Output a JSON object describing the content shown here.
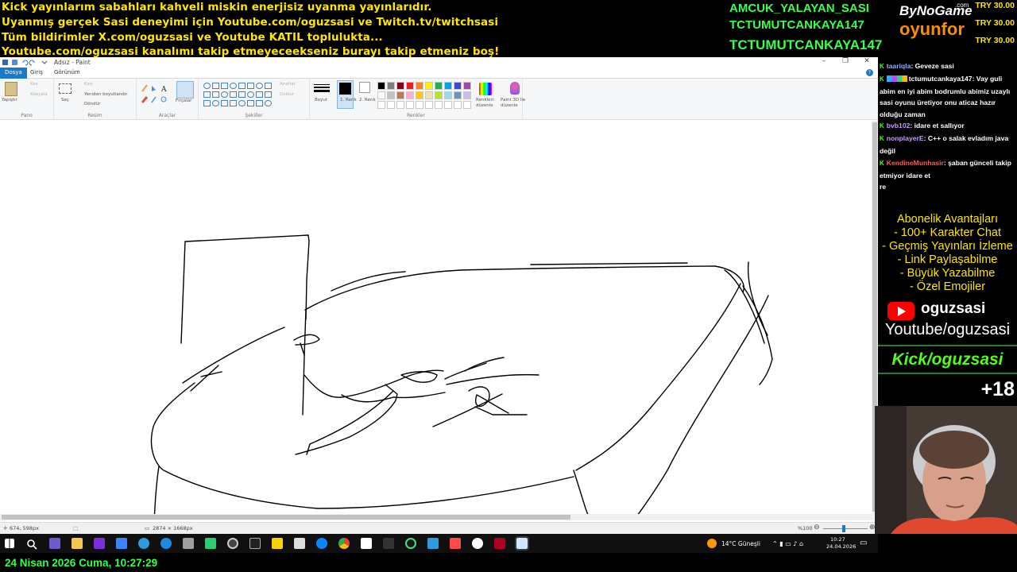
{
  "banner": {
    "lines": [
      "Kick yayınlarım sabahları kahveli miskin enerjisiz uyanma yayınlarıdır.",
      "Uyanmış gerçek Sasi deneyimi için Youtube.com/oguzsasi ve Twitch.tv/twitchsasi",
      "Tüm bildirimler X.com/oguzsasi ve Youtube KATIL topluluktа...",
      "Youtube.com/oguzsasi kanalımı takip etmeyeceekseniz burayı takip etmeniz boş!"
    ],
    "top_names": [
      "AMCUK_YALAYAN_SASI",
      "TCTUMUTCANKAYA147",
      "TCTUMUTCANKAYA147"
    ],
    "brand_line1": "ByNoGame",
    "brand_suffix": ".com",
    "brand_line2": "oyunfor",
    "donations": [
      "TRY 30.00",
      "TRY 30.00",
      "TRY 30.00"
    ]
  },
  "paint": {
    "window_title": "Adsız - Paint",
    "menu_tabs": [
      "Dosya",
      "Giriş",
      "Görünüm"
    ],
    "ribbon": {
      "paste_label": "Yapıştır",
      "cut_label": "Kes",
      "copy_label": "Kopyala",
      "select_label": "Seç",
      "crop_label": "Kırp",
      "resize_label": "Yeniden boyutlandır",
      "rotate_label": "Döndür",
      "brushes_label": "Fırçalar",
      "outline_label": "Anahat",
      "fill_label": "Doldur",
      "size_label": "Boyut",
      "color1_label": "1. Renk",
      "color2_label": "2. Renk",
      "edit_colors_label": "Renkleri düzenle",
      "paint3d_label": "Paint 3D ile düzenle",
      "groups": [
        "Pano",
        "Resim",
        "Araçlar",
        "Şekiller",
        "Renkler"
      ]
    },
    "palette": [
      "#000000",
      "#7f7f7f",
      "#880015",
      "#ed1c24",
      "#ff7f27",
      "#fff200",
      "#22b14c",
      "#00a2e8",
      "#3f48cc",
      "#a349a4",
      "#ffffff",
      "#c3c3c3",
      "#b97a57",
      "#ffaec9",
      "#ffc90e",
      "#efe4b0",
      "#b5e61d",
      "#99d9ea",
      "#7092be",
      "#c8bfe7"
    ],
    "status": {
      "cursor_pos": "674, 598px",
      "canvas_size": "2874 × 1668px",
      "zoom": "%100"
    }
  },
  "chat": {
    "messages": [
      {
        "user": "taariqla",
        "user_color": "#8ab4ff",
        "text": ": Geveze sasi",
        "badges": false
      },
      {
        "user": "tctumutcankaya147",
        "user_color": "#ffffff",
        "text": ": Vay guli abim en iyi abim bodrumlu abimiz uzaylı sasi oyunu üretiyor onu aticaz hazır olduğu zaman",
        "badges": true
      },
      {
        "user": "bvb102",
        "user_color": "#c59cff",
        "text": ": idare et sallıyor",
        "badges": false
      },
      {
        "user": "nonplayerE",
        "user_color": "#c59cff",
        "text": ": C++ o salak evladım java değil",
        "badges": false
      },
      {
        "user": "KendineMunhasir",
        "user_color": "#ff5a5a",
        "text": ": şaban günceli takip etmiyor idare et",
        "badges": false
      }
    ],
    "trailing": "re"
  },
  "perks": {
    "title": "Abonelik Avantajları",
    "items": [
      "- 100+ Karakter Chat",
      "- Geçmiş Yayınları İzleme",
      "- Link Paylaşabilme",
      "- Büyük Yazabilme",
      "- Özel Emojiler"
    ]
  },
  "social": {
    "yt_name": "oguzsasi",
    "yt_url": "Youtube/oguzsasi",
    "kick": "Kick/oguzsasi",
    "plus": "+18"
  },
  "taskbar": {
    "weather": "14°C  Güneşli",
    "time": "10:27",
    "date": "24.04.2026"
  },
  "overlay_datetime": "24 Nisan 2026 Cuma, 10:27:29"
}
